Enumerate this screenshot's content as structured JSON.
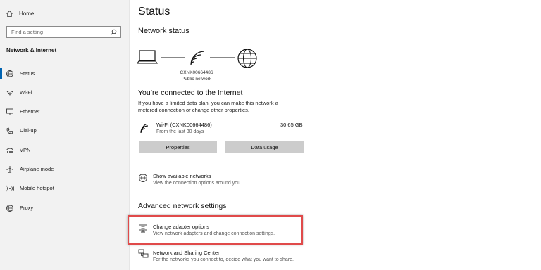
{
  "sidebar": {
    "home_label": "Home",
    "search_placeholder": "Find a setting",
    "section_title": "Network & Internet",
    "items": [
      {
        "label": "Status",
        "icon": "globe-status-icon",
        "active": true
      },
      {
        "label": "Wi-Fi",
        "icon": "wifi-icon"
      },
      {
        "label": "Ethernet",
        "icon": "ethernet-icon"
      },
      {
        "label": "Dial-up",
        "icon": "dial-up-icon"
      },
      {
        "label": "VPN",
        "icon": "vpn-icon"
      },
      {
        "label": "Airplane mode",
        "icon": "airplane-icon"
      },
      {
        "label": "Mobile hotspot",
        "icon": "hotspot-icon"
      },
      {
        "label": "Proxy",
        "icon": "globe-icon"
      }
    ]
  },
  "main": {
    "page_title": "Status",
    "network_status_heading": "Network status",
    "network_name": "CXNK00664486",
    "network_type": "Public network",
    "connected_heading": "You’re connected to the Internet",
    "connected_desc_line1": "If you have a limited data plan, you can make this network a",
    "connected_desc_line2": "metered connection or change other properties.",
    "connection": {
      "name": "Wi-Fi (CXNK00664486)",
      "period": "From the last 30 days",
      "usage": "30.65 GB"
    },
    "properties_button": "Properties",
    "data_usage_button": "Data usage",
    "show_networks": {
      "title": "Show available networks",
      "desc": "View the connection options around you."
    },
    "advanced_heading": "Advanced network settings",
    "adapter_options": {
      "title": "Change adapter options",
      "desc": "View network adapters and change connection settings."
    },
    "sharing_center": {
      "title": "Network and Sharing Center",
      "desc": "For the networks you connect to, decide what you want to share."
    }
  },
  "colors": {
    "accent": "#0063b1",
    "highlight": "#e04a4a",
    "sidebar_bg": "#f2f2f2",
    "button_bg": "#cccccc"
  }
}
